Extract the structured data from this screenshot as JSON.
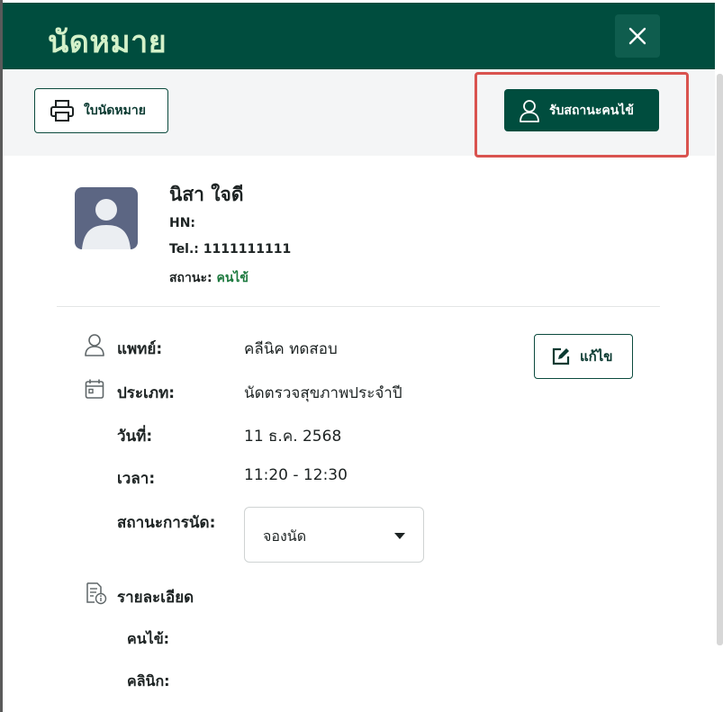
{
  "header": {
    "title": "นัดหมาย",
    "close_icon": "close-icon"
  },
  "toolbar": {
    "print_label": "ใบนัดหมาย",
    "print_icon": "printer-icon",
    "receive_label": "รับสถานะคนไข้",
    "receive_icon": "user-icon"
  },
  "patient": {
    "name": "นิสา ใจดี",
    "hn_label": "HN:",
    "hn_value": "",
    "tel_label": "Tel.:",
    "tel_value": "1111111111",
    "status_label": "สถานะ:",
    "status_value": "คนไข้"
  },
  "appointment": {
    "doctor_label": "แพทย์:",
    "doctor_value": "คลีนิค ทดสอบ",
    "type_label": "ประเภท:",
    "type_value": "นัดตรวจสุขภาพประจำปี",
    "date_label": "วันที่:",
    "date_value": "11 ธ.ค. 2568",
    "time_label": "เวลา:",
    "time_value": "11:20 - 12:30",
    "status_label": "สถานะการนัด:",
    "status_selected": "จองนัด",
    "edit_label": "แก้ไข"
  },
  "details": {
    "title": "รายละเอียด",
    "patient_label": "คนไข้:",
    "clinic_label": "คลินิก:"
  },
  "colors": {
    "brand": "#004d3e",
    "title_text": "#d4f1c9",
    "highlight": "#d9534f",
    "status_green": "#1d7a3f"
  }
}
